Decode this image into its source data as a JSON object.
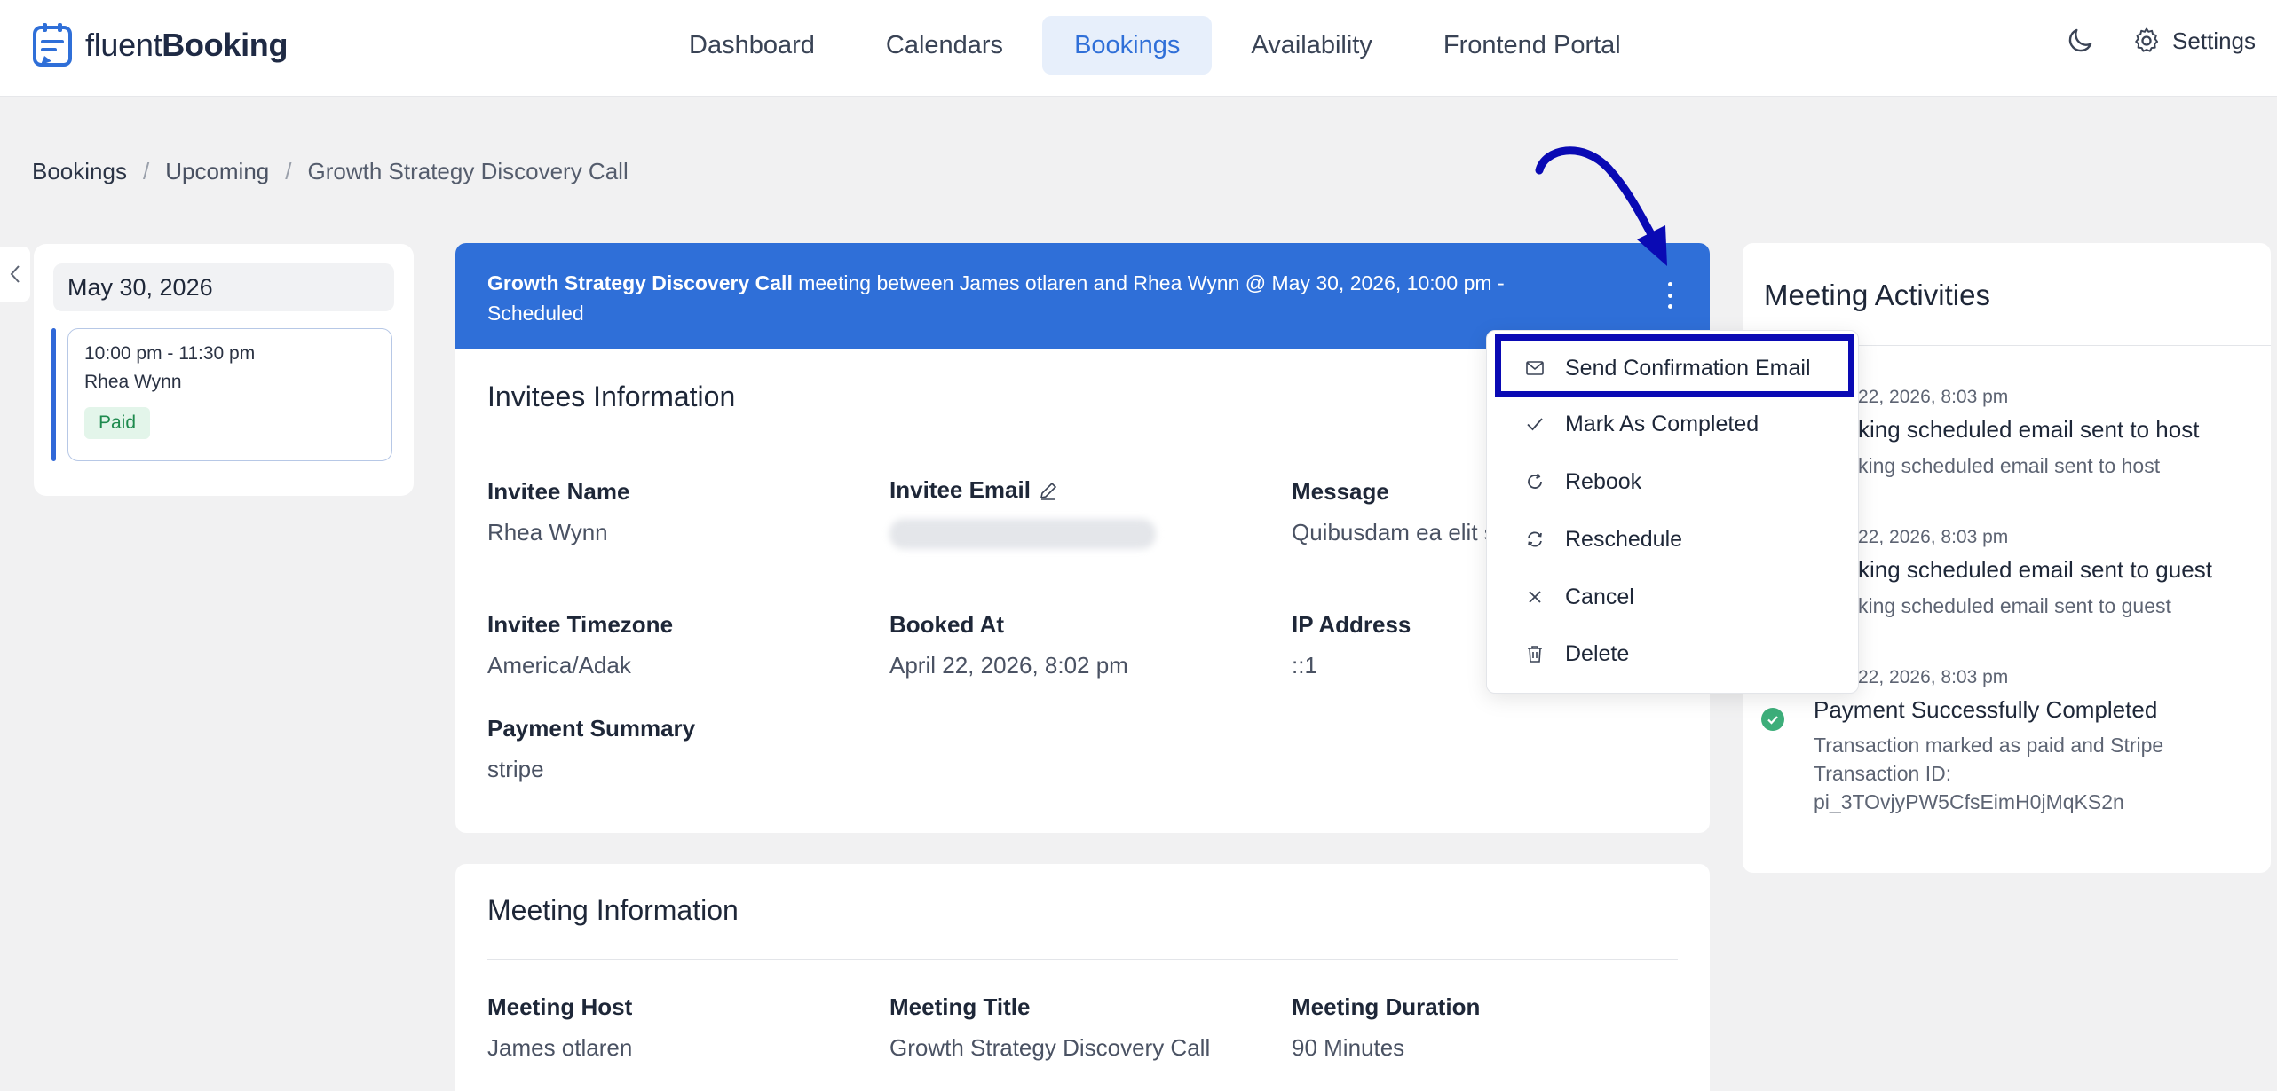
{
  "brand": {
    "name_part1": "fluent",
    "name_part2": "Booking"
  },
  "nav": [
    {
      "label": "Dashboard"
    },
    {
      "label": "Calendars"
    },
    {
      "label": "Bookings",
      "active": true
    },
    {
      "label": "Availability"
    },
    {
      "label": "Frontend Portal"
    }
  ],
  "settings_label": "Settings",
  "breadcrumb": [
    "Bookings",
    "Upcoming",
    "Growth Strategy Discovery Call"
  ],
  "calendar": {
    "date": "May 30, 2026",
    "slot_time": "10:00 pm - 11:30 pm",
    "slot_name": "Rhea Wynn",
    "badge": "Paid"
  },
  "banner": {
    "title": "Growth Strategy Discovery Call",
    "rest_line1": " meeting between James otlaren and Rhea Wynn @ May 30, 2026, 10:00 pm -",
    "rest_line2": "Scheduled"
  },
  "invitees": {
    "title": "Invitees Information",
    "name_label": "Invitee Name",
    "name_value": "Rhea Wynn",
    "email_label": "Invitee Email",
    "message_label": "Message",
    "message_value": "Quibusdam ea elit s",
    "timezone_label": "Invitee Timezone",
    "timezone_value": "America/Adak",
    "booked_label": "Booked At",
    "booked_value": "April 22, 2026, 8:02 pm",
    "ip_label": "IP Address",
    "ip_value": "::1",
    "payment_label": "Payment Summary",
    "payment_value": "stripe"
  },
  "meeting": {
    "title": "Meeting Information",
    "host_label": "Meeting Host",
    "host_value": "James otlaren",
    "mtitle_label": "Meeting Title",
    "mtitle_value": "Growth Strategy Discovery Call",
    "duration_label": "Meeting Duration",
    "duration_value": "90 Minutes"
  },
  "dropdown": [
    {
      "label": "Send Confirmation Email",
      "icon": "mail-icon"
    },
    {
      "label": "Mark As Completed",
      "icon": "check-icon"
    },
    {
      "label": "Rebook",
      "icon": "refresh-icon"
    },
    {
      "label": "Reschedule",
      "icon": "reschedule-icon"
    },
    {
      "label": "Cancel",
      "icon": "close-icon"
    },
    {
      "label": "Delete",
      "icon": "trash-icon"
    }
  ],
  "activities": {
    "title": "Meeting Activities",
    "items": [
      {
        "time": "22, 2026, 8:03 pm",
        "head": "king scheduled email sent to host",
        "sub": "king scheduled email sent to host"
      },
      {
        "time": "22, 2026, 8:03 pm",
        "head": "king scheduled email sent to guest",
        "sub": "king scheduled email sent to guest"
      },
      {
        "time": "22, 2026, 8:03 pm",
        "head": "Payment Successfully Completed",
        "sub1": "Transaction marked as paid and Stripe",
        "sub2": "Transaction ID:",
        "sub3": "pi_3TOvjyPW5CfsEimH0jMqKS2n"
      }
    ]
  },
  "colors": {
    "accent": "#2f6fd8",
    "highlight": "#0a0ab4",
    "success": "#3dae7a"
  }
}
